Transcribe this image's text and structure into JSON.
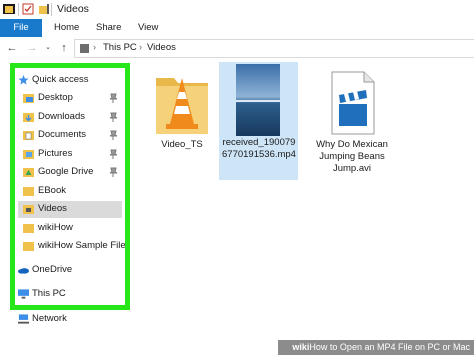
{
  "window": {
    "title": "Videos"
  },
  "ribbon": {
    "file_label": "File",
    "tabs": [
      "Home",
      "Share",
      "View"
    ],
    "file_color": "#1979ca"
  },
  "address": {
    "crumbs": [
      "This PC",
      "Videos"
    ]
  },
  "navpane": {
    "highlight_color": "#27e619",
    "items": [
      {
        "label": "Quick access",
        "icon": "star-icon"
      },
      {
        "label": "Desktop",
        "icon": "desktop-folder-icon",
        "pinned": true
      },
      {
        "label": "Downloads",
        "icon": "downloads-folder-icon",
        "pinned": true
      },
      {
        "label": "Documents",
        "icon": "documents-folder-icon",
        "pinned": true
      },
      {
        "label": "Pictures",
        "icon": "pictures-folder-icon",
        "pinned": true
      },
      {
        "label": "Google Drive",
        "icon": "google-drive-folder-icon",
        "pinned": true
      },
      {
        "label": "EBook",
        "icon": "folder-icon"
      },
      {
        "label": "Videos",
        "icon": "videos-folder-icon",
        "selected": true
      },
      {
        "label": "wikiHow",
        "icon": "folder-icon"
      },
      {
        "label": "wikiHow Sample File",
        "icon": "folder-icon"
      },
      {
        "label": "OneDrive",
        "icon": "onedrive-icon"
      },
      {
        "label": "This PC",
        "icon": "this-pc-icon"
      },
      {
        "label": "Network",
        "icon": "network-icon"
      }
    ]
  },
  "files": [
    {
      "name": "Video_TS",
      "icon": "vlc-folder-icon"
    },
    {
      "name": "received_1900796770191536.mp4",
      "icon": "video-thumbnail-icon",
      "selected": true
    },
    {
      "name": "Why Do Mexican Jumping Beans Jump.avi",
      "icon": "clapperboard-icon"
    }
  ],
  "watermark": {
    "brand": "wiki",
    "text": "How to Open an MP4 File on PC or Mac"
  }
}
